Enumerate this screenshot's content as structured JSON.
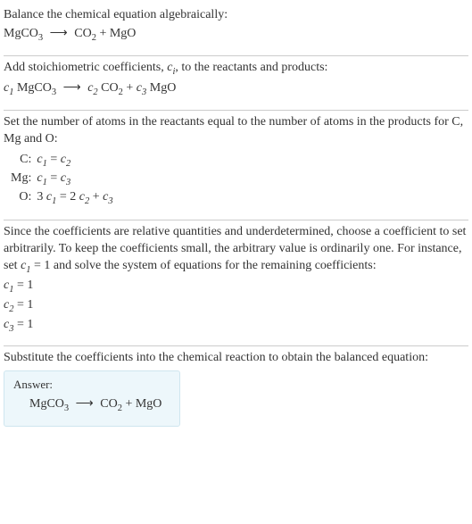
{
  "intro": {
    "line1": "Balance the chemical equation algebraically:"
  },
  "eq1": {
    "lhs1": "MgCO",
    "lhs1_sub": "3",
    "arrow": "⟶",
    "rhs1": "CO",
    "rhs1_sub": "2",
    "plus": " + ",
    "rhs2": "MgO"
  },
  "step2": {
    "text_a": "Add stoichiometric coefficients, ",
    "ci": "c",
    "ci_sub": "i",
    "text_b": ", to the reactants and products:"
  },
  "eq2": {
    "c1": "c",
    "c1_sub": "1",
    "sp1": " MgCO",
    "sp1_sub": "3",
    "arrow": "⟶",
    "c2": "c",
    "c2_sub": "2",
    "sp2": " CO",
    "sp2_sub": "2",
    "plus": " + ",
    "c3": "c",
    "c3_sub": "3",
    "sp3": " MgO"
  },
  "step3": {
    "text": "Set the number of atoms in the reactants equal to the number of atoms in the products for C, Mg and O:"
  },
  "atoms": {
    "rows": [
      {
        "elem": "C:",
        "lhs_a": "c",
        "lhs_as": "1",
        "eq": " = ",
        "rhs_a": "c",
        "rhs_as": "2",
        "extra": ""
      },
      {
        "elem": "Mg:",
        "lhs_a": "c",
        "lhs_as": "1",
        "eq": " = ",
        "rhs_a": "c",
        "rhs_as": "3",
        "extra": ""
      },
      {
        "elem": "O:",
        "lhs_pre": "3 ",
        "lhs_a": "c",
        "lhs_as": "1",
        "eq": " = ",
        "rhs_pre": "2 ",
        "rhs_a": "c",
        "rhs_as": "2",
        "plus": " + ",
        "rhs_b": "c",
        "rhs_bs": "3"
      }
    ]
  },
  "step4": {
    "text_a": "Since the coefficients are relative quantities and underdetermined, choose a coefficient to set arbitrarily. To keep the coefficients small, the arbitrary value is ordinarily one. For instance, set ",
    "c1": "c",
    "c1_sub": "1",
    "text_b": " = 1 and solve the system of equations for the remaining coefficients:"
  },
  "coefs": {
    "l1_a": "c",
    "l1_s": "1",
    "l1_v": " = 1",
    "l2_a": "c",
    "l2_s": "2",
    "l2_v": " = 1",
    "l3_a": "c",
    "l3_s": "3",
    "l3_v": " = 1"
  },
  "step5": {
    "text": "Substitute the coefficients into the chemical reaction to obtain the balanced equation:"
  },
  "answer": {
    "label": "Answer:",
    "lhs1": "MgCO",
    "lhs1_sub": "3",
    "arrow": "⟶",
    "rhs1": "CO",
    "rhs1_sub": "2",
    "plus": " + ",
    "rhs2": "MgO"
  }
}
